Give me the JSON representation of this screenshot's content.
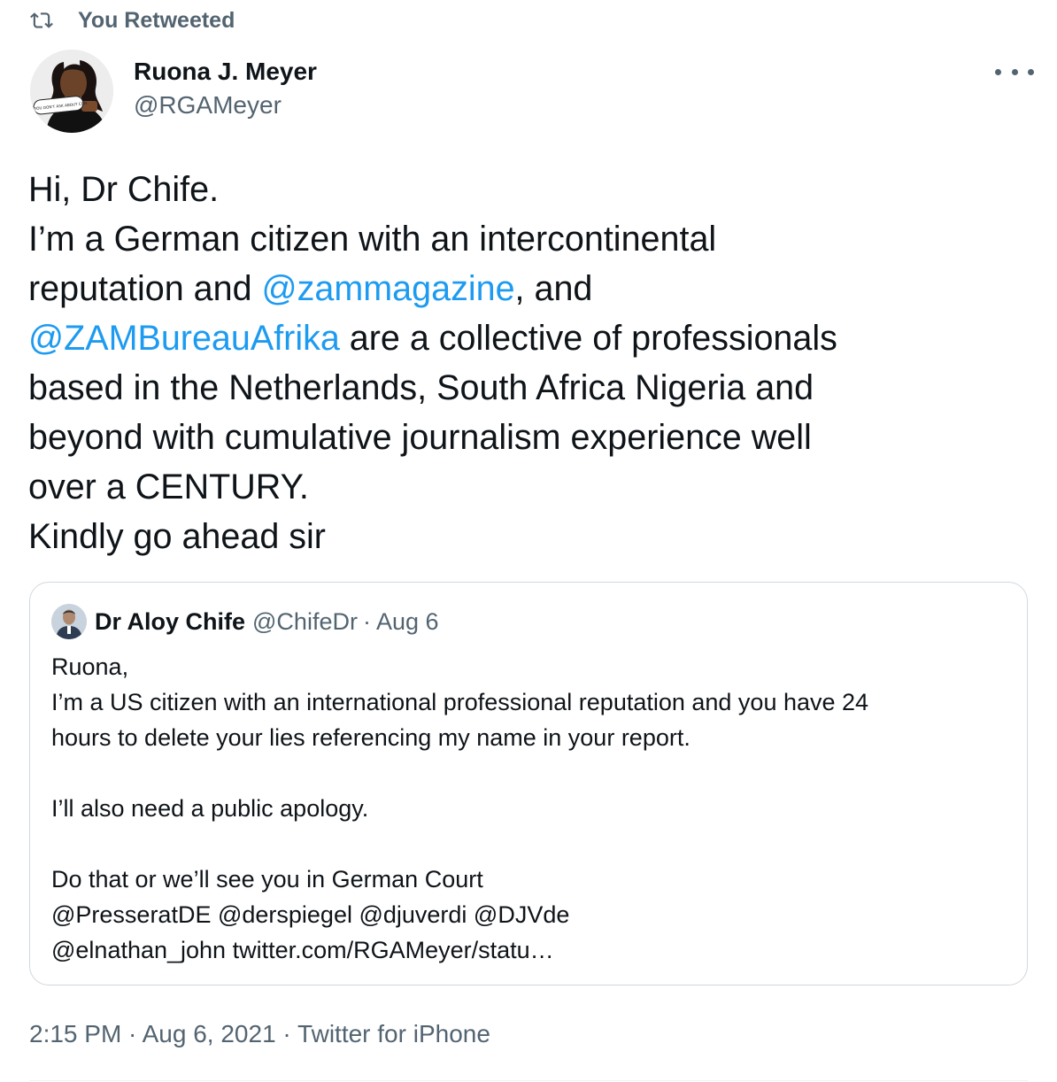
{
  "retweet": {
    "label": "You Retweeted",
    "icon": "retweet-icon"
  },
  "author": {
    "display_name": "Ruona J. Meyer",
    "handle": "@RGAMeyer",
    "avatar_sign_text": "IF YOU DON'T ASK ABOUT CON"
  },
  "tweet": {
    "line1": "Hi, Dr Chife.",
    "line2": "I’m a German citizen with an intercontinental",
    "line3_pre": "reputation and ",
    "line3_mention": "@zammagazine",
    "line3_post": ", and",
    "line4_mention": "@ZAMBureauAfrika",
    "line4_post": " are a collective of professionals",
    "line5": "based in the Netherlands, South Africa Nigeria and",
    "line6": "beyond with cumulative journalism experience well",
    "line7": "over a CENTURY.",
    "line8": "Kindly go ahead sir"
  },
  "quote": {
    "display_name": "Dr Aloy Chife",
    "handle": "@ChifeDr",
    "separator": "·",
    "date": "Aug 6",
    "lines": [
      "Ruona,",
      "I’m a US citizen with an international professional reputation and you have 24",
      "hours to delete your lies referencing my name in your report.",
      "",
      "I’ll also need a public apology.",
      "",
      "Do that or we’ll see you in German Court",
      "@PresseratDE @derspiegel @djuverdi @DJVde",
      "@elnathan_john twitter.com/RGAMeyer/statu…"
    ]
  },
  "meta": {
    "time": "2:15 PM",
    "sep1": " · ",
    "date": "Aug 6, 2021",
    "sep2": " · ",
    "source": "Twitter for iPhone"
  },
  "colors": {
    "link": "#1d9bf0",
    "secondary": "#536471",
    "text": "#0f1419",
    "border": "#cfd9de"
  }
}
